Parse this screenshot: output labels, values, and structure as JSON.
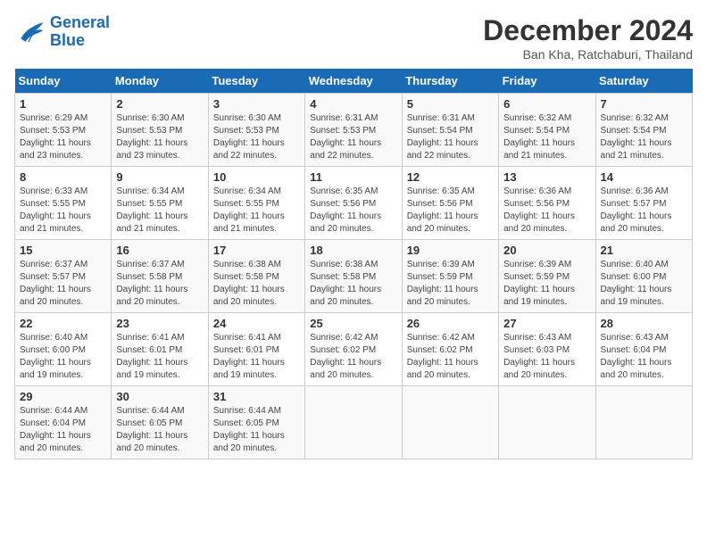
{
  "logo": {
    "line1": "General",
    "line2": "Blue"
  },
  "title": "December 2024",
  "location": "Ban Kha, Ratchaburi, Thailand",
  "days_of_week": [
    "Sunday",
    "Monday",
    "Tuesday",
    "Wednesday",
    "Thursday",
    "Friday",
    "Saturday"
  ],
  "weeks": [
    [
      {
        "day": 1,
        "rise": "6:29 AM",
        "set": "5:53 PM",
        "daylight": "11 hours and 23 minutes."
      },
      {
        "day": 2,
        "rise": "6:30 AM",
        "set": "5:53 PM",
        "daylight": "11 hours and 23 minutes."
      },
      {
        "day": 3,
        "rise": "6:30 AM",
        "set": "5:53 PM",
        "daylight": "11 hours and 22 minutes."
      },
      {
        "day": 4,
        "rise": "6:31 AM",
        "set": "5:53 PM",
        "daylight": "11 hours and 22 minutes."
      },
      {
        "day": 5,
        "rise": "6:31 AM",
        "set": "5:54 PM",
        "daylight": "11 hours and 22 minutes."
      },
      {
        "day": 6,
        "rise": "6:32 AM",
        "set": "5:54 PM",
        "daylight": "11 hours and 21 minutes."
      },
      {
        "day": 7,
        "rise": "6:32 AM",
        "set": "5:54 PM",
        "daylight": "11 hours and 21 minutes."
      }
    ],
    [
      {
        "day": 8,
        "rise": "6:33 AM",
        "set": "5:55 PM",
        "daylight": "11 hours and 21 minutes."
      },
      {
        "day": 9,
        "rise": "6:34 AM",
        "set": "5:55 PM",
        "daylight": "11 hours and 21 minutes."
      },
      {
        "day": 10,
        "rise": "6:34 AM",
        "set": "5:55 PM",
        "daylight": "11 hours and 21 minutes."
      },
      {
        "day": 11,
        "rise": "6:35 AM",
        "set": "5:56 PM",
        "daylight": "11 hours and 20 minutes."
      },
      {
        "day": 12,
        "rise": "6:35 AM",
        "set": "5:56 PM",
        "daylight": "11 hours and 20 minutes."
      },
      {
        "day": 13,
        "rise": "6:36 AM",
        "set": "5:56 PM",
        "daylight": "11 hours and 20 minutes."
      },
      {
        "day": 14,
        "rise": "6:36 AM",
        "set": "5:57 PM",
        "daylight": "11 hours and 20 minutes."
      }
    ],
    [
      {
        "day": 15,
        "rise": "6:37 AM",
        "set": "5:57 PM",
        "daylight": "11 hours and 20 minutes."
      },
      {
        "day": 16,
        "rise": "6:37 AM",
        "set": "5:58 PM",
        "daylight": "11 hours and 20 minutes."
      },
      {
        "day": 17,
        "rise": "6:38 AM",
        "set": "5:58 PM",
        "daylight": "11 hours and 20 minutes."
      },
      {
        "day": 18,
        "rise": "6:38 AM",
        "set": "5:58 PM",
        "daylight": "11 hours and 20 minutes."
      },
      {
        "day": 19,
        "rise": "6:39 AM",
        "set": "5:59 PM",
        "daylight": "11 hours and 20 minutes."
      },
      {
        "day": 20,
        "rise": "6:39 AM",
        "set": "5:59 PM",
        "daylight": "11 hours and 19 minutes."
      },
      {
        "day": 21,
        "rise": "6:40 AM",
        "set": "6:00 PM",
        "daylight": "11 hours and 19 minutes."
      }
    ],
    [
      {
        "day": 22,
        "rise": "6:40 AM",
        "set": "6:00 PM",
        "daylight": "11 hours and 19 minutes."
      },
      {
        "day": 23,
        "rise": "6:41 AM",
        "set": "6:01 PM",
        "daylight": "11 hours and 19 minutes."
      },
      {
        "day": 24,
        "rise": "6:41 AM",
        "set": "6:01 PM",
        "daylight": "11 hours and 19 minutes."
      },
      {
        "day": 25,
        "rise": "6:42 AM",
        "set": "6:02 PM",
        "daylight": "11 hours and 20 minutes."
      },
      {
        "day": 26,
        "rise": "6:42 AM",
        "set": "6:02 PM",
        "daylight": "11 hours and 20 minutes."
      },
      {
        "day": 27,
        "rise": "6:43 AM",
        "set": "6:03 PM",
        "daylight": "11 hours and 20 minutes."
      },
      {
        "day": 28,
        "rise": "6:43 AM",
        "set": "6:04 PM",
        "daylight": "11 hours and 20 minutes."
      }
    ],
    [
      {
        "day": 29,
        "rise": "6:44 AM",
        "set": "6:04 PM",
        "daylight": "11 hours and 20 minutes."
      },
      {
        "day": 30,
        "rise": "6:44 AM",
        "set": "6:05 PM",
        "daylight": "11 hours and 20 minutes."
      },
      {
        "day": 31,
        "rise": "6:44 AM",
        "set": "6:05 PM",
        "daylight": "11 hours and 20 minutes."
      },
      null,
      null,
      null,
      null
    ]
  ]
}
